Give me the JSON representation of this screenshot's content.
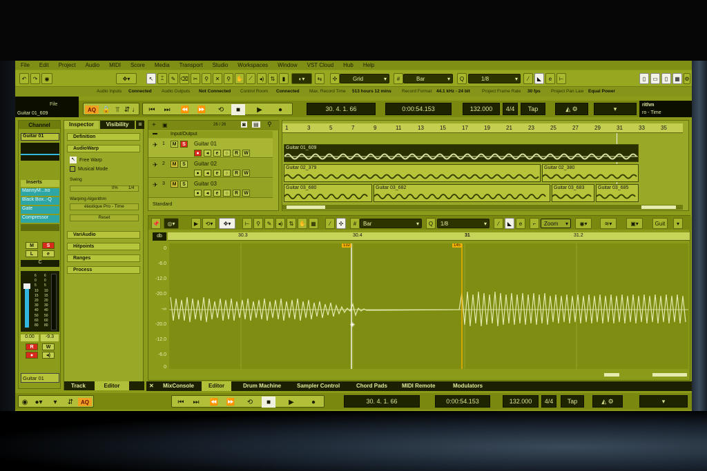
{
  "menu": [
    "File",
    "Edit",
    "Project",
    "Audio",
    "MIDI",
    "Score",
    "Media",
    "Transport",
    "Studio",
    "Workspaces",
    "Window",
    "VST Cloud",
    "Hub",
    "Help"
  ],
  "toolbar": {
    "snap_type": "Grid",
    "grid_type": "Bar",
    "quantize_prefix": "Q",
    "quantize": "1/8"
  },
  "status": {
    "audio_inputs_label": "Audio Inputs",
    "audio_inputs": "Connected",
    "audio_outputs_label": "Audio Outputs",
    "audio_outputs": "Not Connected",
    "control_room_label": "Control Room",
    "control_room": "Connected",
    "max_record_label": "Max. Record Time",
    "max_record": "513 hours 12 mins",
    "record_format_label": "Record Format",
    "record_format": "44.1 kHz - 24 bit",
    "frame_rate_label": "Project Frame Rate",
    "frame_rate": "30 fps",
    "pan_law_label": "Project Pan Law",
    "pan_law": "Equal Power"
  },
  "infoline": {
    "file_label": "File",
    "file_value": "Guitar 01_609",
    "right_prefix": "rithm",
    "right_value": "ro - Time"
  },
  "transport": {
    "aq": "AQ",
    "position": "30. 4. 1. 66",
    "time": "0:00:54.153",
    "tempo": "132.000",
    "signature": "4/4",
    "tap": "Tap"
  },
  "channel": {
    "title": "Channel",
    "track_name": "Guitar 01",
    "inserts_label": "Inserts",
    "inserts": [
      "MannyM...no",
      "Black Box..-Q",
      "Gate",
      "Compressor"
    ],
    "m": "M",
    "s": "S",
    "l": "L",
    "e": "e",
    "pan": "C",
    "vol": "0.00",
    "peak": "-9.3",
    "r": "R",
    "w": "W",
    "bottom_name": "Guitar 01",
    "fader_scale": [
      "6",
      "0",
      "5",
      "10",
      "15",
      "20",
      "30",
      "40",
      "50",
      "60",
      "80"
    ],
    "meter_scale": [
      "6",
      "0",
      "5",
      "10",
      "15",
      "20",
      "30",
      "40",
      "50",
      "60",
      "80"
    ]
  },
  "inspector": {
    "tab_inspector": "Inspector",
    "tab_visibility": "Visibility",
    "definition": "Definition",
    "audiowarp": "AudioWarp",
    "free_warp": "Free Warp",
    "musical_mode": "Musical Mode",
    "swing": "Swing",
    "swing_value": "0%",
    "swing_grid": "1/4",
    "warp_algo_label": "Warping Algorithm",
    "warp_algo": "élastique Pro - Time",
    "reset": "Reset",
    "variaudio": "VariAudio",
    "hitpoints": "Hitpoints",
    "ranges": "Ranges",
    "process": "Process",
    "tab_track": "Track",
    "tab_editor": "Editor"
  },
  "tracklist": {
    "counter": "26 / 26",
    "folder": "Input/Output",
    "standard": "Standard",
    "tracks": [
      {
        "num": "1",
        "name": "Guitar 01"
      },
      {
        "num": "2",
        "name": "Guitar 02"
      },
      {
        "num": "3",
        "name": "Guitar 03"
      }
    ],
    "btn_m": "M",
    "btn_s": "S",
    "btn_e": "e",
    "btn_r": "R",
    "btn_w": "W"
  },
  "ruler": {
    "marks": [
      "1",
      "3",
      "5",
      "7",
      "9",
      "11",
      "13",
      "15",
      "17",
      "19",
      "21",
      "23",
      "25",
      "27",
      "29",
      "31",
      "33",
      "35"
    ]
  },
  "clips": [
    {
      "name": "Guitar 01_609"
    },
    {
      "name": "Guitar 02_379"
    },
    {
      "name": "Guitar 02_380"
    },
    {
      "name": "Guitar 03_680"
    },
    {
      "name": "Guitar 03_682"
    },
    {
      "name": "Guitar 03_683"
    },
    {
      "name": "Guitar 03_685"
    }
  ],
  "editor": {
    "grid": "Bar",
    "quantize_prefix": "Q",
    "quantize": "1/8",
    "zoom": "Zoom",
    "db": "db",
    "ruler": [
      "30.3",
      "30.4",
      "31",
      "31.2"
    ],
    "ymarks": [
      "0",
      "-6.0",
      "-12.0",
      "-20.0",
      "-∞",
      "-20.0",
      "-12.0",
      "-6.0",
      "0"
    ],
    "right_label": "Guit",
    "marker1": "132",
    "marker2": "145"
  },
  "bottom_tabs": [
    "MixConsole",
    "Editor",
    "Drum Machine",
    "Sampler Control",
    "Chord Pads",
    "MIDI Remote",
    "Modulators"
  ],
  "colors": {
    "accent": "#8c9a1a",
    "dark": "#1f2400",
    "record": "#d82a1c",
    "solo": "#d82a1c",
    "mute": "#d8c53a"
  }
}
